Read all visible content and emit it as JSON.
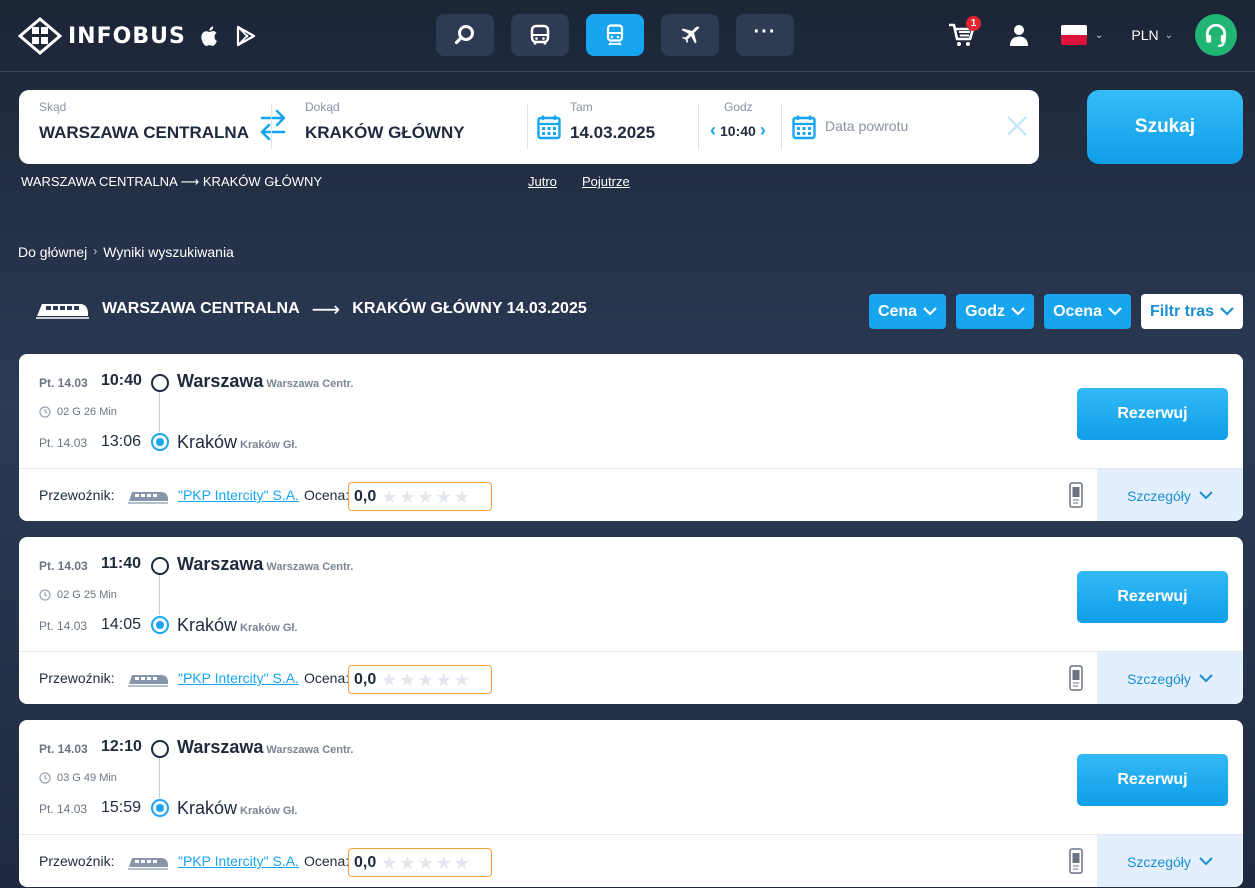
{
  "header": {
    "brand": "INFOBUS",
    "cart_count": "1",
    "currency": "PLN",
    "nav": [
      "search",
      "bus",
      "train",
      "plane",
      "more"
    ],
    "more_label": "···",
    "accent": "#17a5f0"
  },
  "search": {
    "from_label": "Skąd",
    "from_value": "WARSZAWA CENTRALNA",
    "to_label": "Dokąd",
    "to_value": "KRAKÓW GŁÓWNY",
    "date_label": "Tam",
    "date_value": "14.03.2025",
    "time_label": "Godz",
    "time_value": "10:40",
    "return_placeholder": "Data powrotu",
    "submit_label": "Szukaj",
    "route_summary": "WARSZAWA CENTRALNA ⟶ KRAKÓW GŁÓWNY",
    "quick_links": [
      "Jutro",
      "Pojutrze"
    ]
  },
  "breadcrumb": {
    "home": "Do głównej",
    "current": "Wyniki wyszukiwania"
  },
  "route_title": {
    "from": "WARSZAWA CENTRALNA",
    "to": "KRAKÓW GŁÓWNY 14.03.2025"
  },
  "filters": [
    "Cena",
    "Godz",
    "Ocena",
    "Filtr tras"
  ],
  "results": [
    {
      "dep_date": "Pt. 14.03",
      "dep_time": "10:40",
      "dep_city": "Warszawa",
      "dep_station": "Warszawa Centr.",
      "duration": "02 G 26 Min",
      "arr_date": "Pt. 14.03",
      "arr_time": "13:06",
      "arr_city": "Kraków",
      "arr_station": "Kraków Gł.",
      "book_label": "Rezerwuj",
      "carrier_label": "Przewoźnik:",
      "carrier": "\"PKP Intercity\" S.A.",
      "rating_label": "Ocena:",
      "rating": "0,0",
      "details_label": "Szczegóły"
    },
    {
      "dep_date": "Pt. 14.03",
      "dep_time": "11:40",
      "dep_city": "Warszawa",
      "dep_station": "Warszawa Centr.",
      "duration": "02 G 25 Min",
      "arr_date": "Pt. 14.03",
      "arr_time": "14:05",
      "arr_city": "Kraków",
      "arr_station": "Kraków Gł.",
      "book_label": "Rezerwuj",
      "carrier_label": "Przewoźnik:",
      "carrier": "\"PKP Intercity\" S.A.",
      "rating_label": "Ocena:",
      "rating": "0,0",
      "details_label": "Szczegóły"
    },
    {
      "dep_date": "Pt. 14.03",
      "dep_time": "12:10",
      "dep_city": "Warszawa",
      "dep_station": "Warszawa Centr.",
      "duration": "03 G 49 Min",
      "arr_date": "Pt. 14.03",
      "arr_time": "15:59",
      "arr_city": "Kraków",
      "arr_station": "Kraków Gł.",
      "book_label": "Rezerwuj",
      "carrier_label": "Przewoźnik:",
      "carrier": "\"PKP Intercity\" S.A.",
      "rating_label": "Ocena:",
      "rating": "0,0",
      "details_label": "Szczegóły"
    }
  ]
}
